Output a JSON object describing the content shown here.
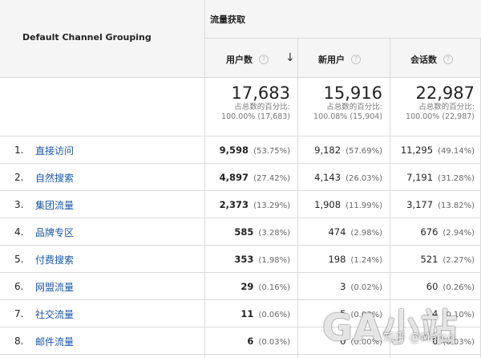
{
  "table": {
    "dimension_header": "Default Channel Grouping",
    "group_header": "流量获取",
    "columns": [
      {
        "label": "用户数",
        "help": "?",
        "sorted_desc": true
      },
      {
        "label": "新用户",
        "help": "?"
      },
      {
        "label": "会话数",
        "help": "?"
      }
    ],
    "sort_arrow": "↓",
    "totals": [
      {
        "value": "17,683",
        "line1": "占总数的百分比:",
        "line2": "100.00% (17,683)"
      },
      {
        "value": "15,916",
        "line1": "占总数的百分比:",
        "line2": "100.08% (15,904)"
      },
      {
        "value": "22,987",
        "line1": "占总数的百分比:",
        "line2": "100.00% (22,987)"
      }
    ],
    "rows": [
      {
        "index": "1.",
        "channel": "直接访问",
        "users": "9,598",
        "users_pct": "(53.75%)",
        "new_users": "9,182",
        "new_users_pct": "(57.69%)",
        "sessions": "11,295",
        "sessions_pct": "(49.14%)"
      },
      {
        "index": "2.",
        "channel": "自然搜索",
        "users": "4,897",
        "users_pct": "(27.42%)",
        "new_users": "4,143",
        "new_users_pct": "(26.03%)",
        "sessions": "7,191",
        "sessions_pct": "(31.28%)"
      },
      {
        "index": "3.",
        "channel": "集团流量",
        "users": "2,373",
        "users_pct": "(13.29%)",
        "new_users": "1,908",
        "new_users_pct": "(11.99%)",
        "sessions": "3,177",
        "sessions_pct": "(13.82%)"
      },
      {
        "index": "4.",
        "channel": "品牌专区",
        "users": "585",
        "users_pct": "(3.28%)",
        "new_users": "474",
        "new_users_pct": "(2.98%)",
        "sessions": "676",
        "sessions_pct": "(2.94%)"
      },
      {
        "index": "5.",
        "channel": "付费搜索",
        "users": "353",
        "users_pct": "(1.98%)",
        "new_users": "198",
        "new_users_pct": "(1.24%)",
        "sessions": "521",
        "sessions_pct": "(2.27%)"
      },
      {
        "index": "6.",
        "channel": "网盟流量",
        "users": "29",
        "users_pct": "(0.16%)",
        "new_users": "3",
        "new_users_pct": "(0.02%)",
        "sessions": "60",
        "sessions_pct": "(0.26%)"
      },
      {
        "index": "7.",
        "channel": "社交流量",
        "users": "11",
        "users_pct": "(0.06%)",
        "new_users": "5",
        "new_users_pct": "(0.03%)",
        "sessions": "24",
        "sessions_pct": "(0.10%)"
      },
      {
        "index": "8.",
        "channel": "邮件流量",
        "users": "6",
        "users_pct": "(0.03%)",
        "new_users": "0",
        "new_users_pct": "(0.00%)",
        "sessions": "6",
        "sessions_pct": "(0.03%)"
      }
    ]
  },
  "watermark": {
    "big": "GA小站",
    "small": "知乎 @Marco"
  }
}
